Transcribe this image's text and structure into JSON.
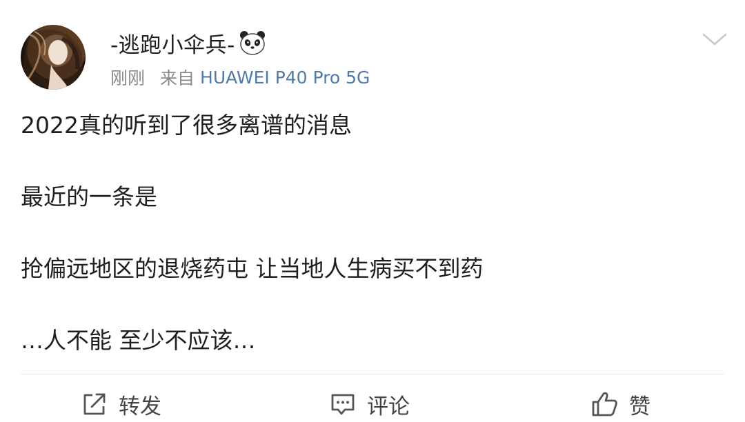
{
  "post": {
    "username": "-逃跑小伞兵-",
    "username_emoji": "panda-icon",
    "time": "刚刚",
    "source_prefix": "来自",
    "device": "HUAWEI P40 Pro 5G",
    "content": [
      "2022真的听到了很多离谱的消息",
      "最近的一条是",
      "抢偏远地区的退烧药屯 让当地人生病买不到药",
      "…人不能 至少不应该…"
    ]
  },
  "actions": {
    "repost_label": "转发",
    "comment_label": "评论",
    "like_label": "赞"
  },
  "colors": {
    "device_link": "#4f7aa8",
    "meta_gray": "#8a8a8a",
    "text": "#1e1e1e",
    "divider": "#e6e6e6"
  }
}
